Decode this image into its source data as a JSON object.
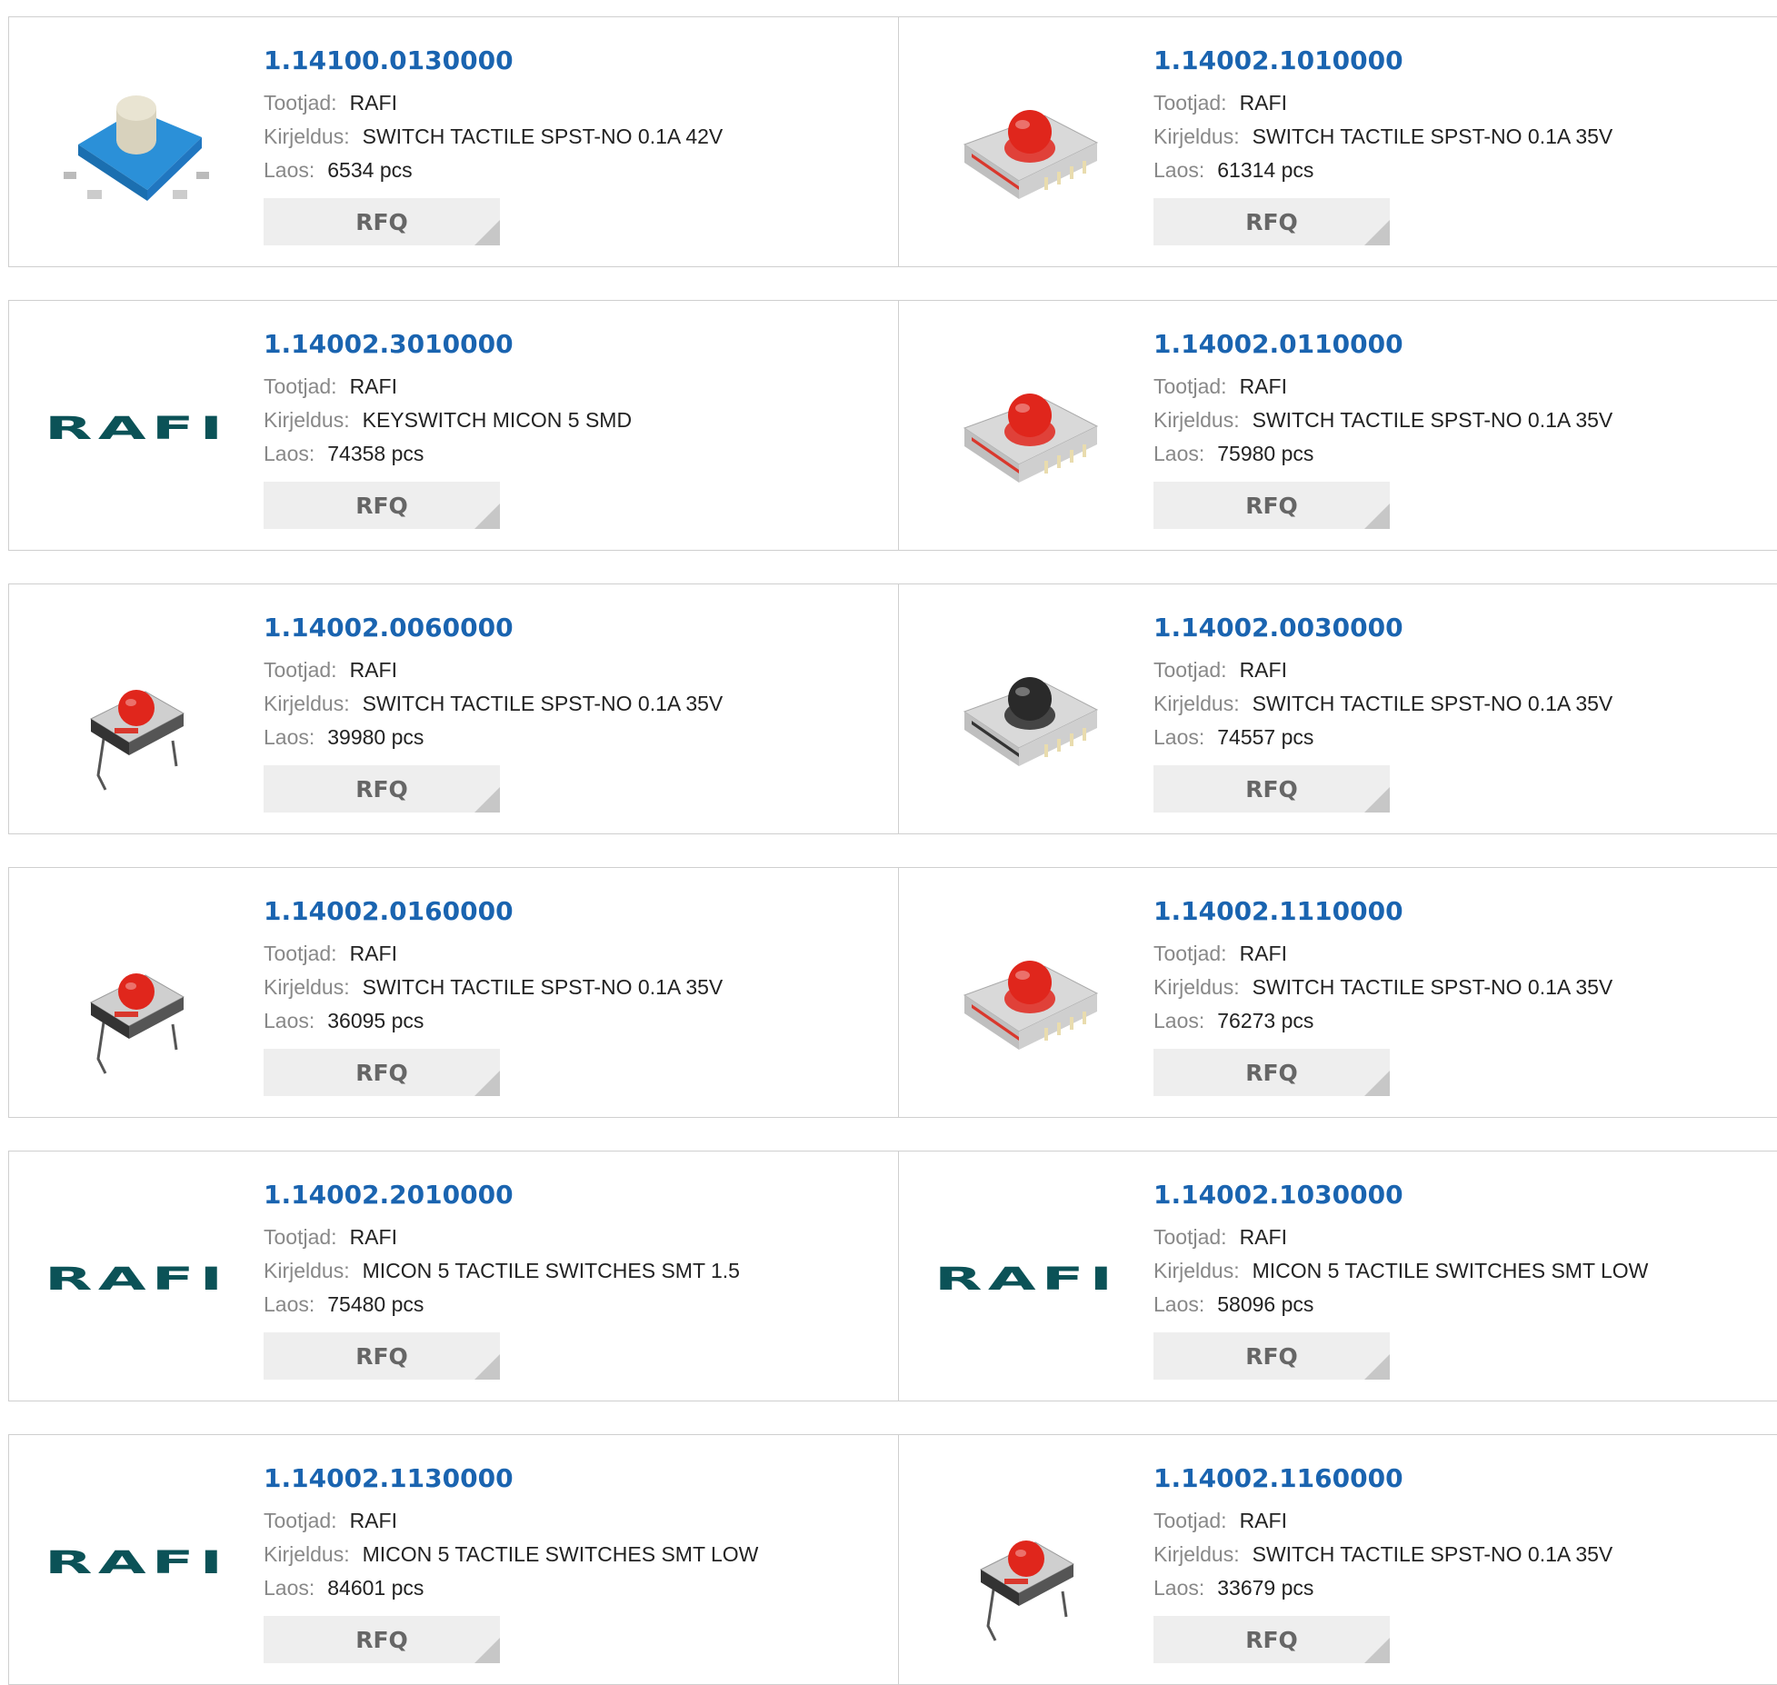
{
  "labels": {
    "manufacturer": "Tootjad:",
    "description": "Kirjeldus:",
    "stock": "Laos:",
    "rfq": "RFQ"
  },
  "colors": {
    "part_link": "#1a64b0",
    "logo": "#0b5257",
    "button_bg": "#eeeeee"
  },
  "products": [
    {
      "part": "1.14100.0130000",
      "manufacturer": "RAFI",
      "description": "SWITCH TACTILE SPST-NO 0.1A 42V",
      "stock": "6534 pcs",
      "image": "blue-tactile-switch"
    },
    {
      "part": "1.14002.1010000",
      "manufacturer": "RAFI",
      "description": "SWITCH TACTILE SPST-NO 0.1A 35V",
      "stock": "61314 pcs",
      "image": "red-smd-switch"
    },
    {
      "part": "1.14002.3010000",
      "manufacturer": "RAFI",
      "description": "KEYSWITCH MICON 5 SMD",
      "stock": "74358 pcs",
      "image": "rafi-logo",
      "logo_text": "RAFI"
    },
    {
      "part": "1.14002.0110000",
      "manufacturer": "RAFI",
      "description": "SWITCH TACTILE SPST-NO 0.1A 35V",
      "stock": "75980 pcs",
      "image": "red-smd-switch-large"
    },
    {
      "part": "1.14002.0060000",
      "manufacturer": "RAFI",
      "description": "SWITCH TACTILE SPST-NO 0.1A 35V",
      "stock": "39980 pcs",
      "image": "red-tht-switch"
    },
    {
      "part": "1.14002.0030000",
      "manufacturer": "RAFI",
      "description": "SWITCH TACTILE SPST-NO 0.1A 35V",
      "stock": "74557 pcs",
      "image": "black-smd-switch"
    },
    {
      "part": "1.14002.0160000",
      "manufacturer": "RAFI",
      "description": "SWITCH TACTILE SPST-NO 0.1A 35V",
      "stock": "36095 pcs",
      "image": "red-tht-switch"
    },
    {
      "part": "1.14002.1110000",
      "manufacturer": "RAFI",
      "description": "SWITCH TACTILE SPST-NO 0.1A 35V",
      "stock": "76273 pcs",
      "image": "red-smd-switch-large"
    },
    {
      "part": "1.14002.2010000",
      "manufacturer": "RAFI",
      "description": "MICON 5 TACTILE SWITCHES SMT 1.5",
      "stock": "75480 pcs",
      "image": "rafi-logo",
      "logo_text": "RAFI"
    },
    {
      "part": "1.14002.1030000",
      "manufacturer": "RAFI",
      "description": "MICON 5 TACTILE SWITCHES SMT LOW",
      "stock": "58096 pcs",
      "image": "rafi-logo",
      "logo_text": "RAFI"
    },
    {
      "part": "1.14002.1130000",
      "manufacturer": "RAFI",
      "description": "MICON 5 TACTILE SWITCHES SMT LOW",
      "stock": "84601 pcs",
      "image": "rafi-logo",
      "logo_text": "RAFI"
    },
    {
      "part": "1.14002.1160000",
      "manufacturer": "RAFI",
      "description": "SWITCH TACTILE SPST-NO 0.1A 35V",
      "stock": "33679 pcs",
      "image": "red-tht-switch"
    }
  ]
}
